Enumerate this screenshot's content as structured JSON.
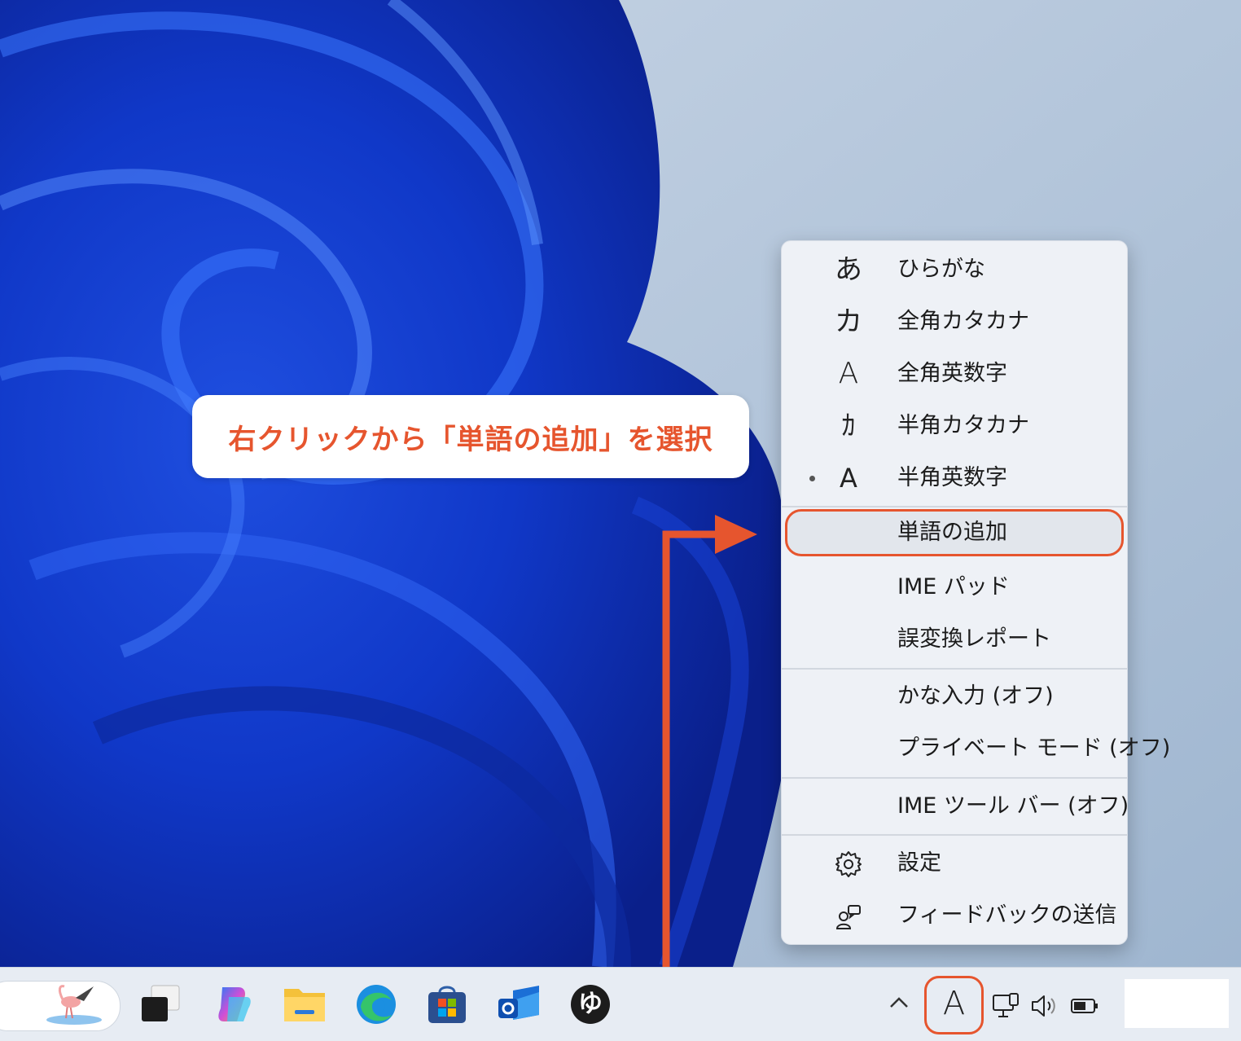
{
  "callout": {
    "text": "右クリックから「単語の追加」を選択"
  },
  "menu": {
    "items": [
      {
        "glyph": "あ",
        "label": "ひらがな",
        "selected": false
      },
      {
        "glyph": "カ",
        "label": "全角カタカナ",
        "selected": false
      },
      {
        "glyph": "A",
        "label": "全角英数字",
        "selected": false
      },
      {
        "glyph": "ｶ",
        "label": "半角カタカナ",
        "selected": false
      },
      {
        "glyph": "A",
        "label": "半角英数字",
        "selected": true
      },
      {
        "glyph": "",
        "label": "単語の追加",
        "highlighted": true
      },
      {
        "glyph": "",
        "label": "IME パッド"
      },
      {
        "glyph": "",
        "label": "誤変換レポート"
      },
      {
        "glyph": "",
        "label": "かな入力 (オフ)"
      },
      {
        "glyph": "",
        "label": "プライベート モード (オフ)"
      },
      {
        "glyph": "",
        "label": "IME ツール バー (オフ)"
      },
      {
        "icon": "gear-icon",
        "label": "設定"
      },
      {
        "icon": "feedback-icon",
        "label": "フィードバックの送信"
      }
    ]
  },
  "taskbar": {
    "apps": [
      "widgets",
      "task-view",
      "copilot",
      "file-explorer",
      "edge",
      "microsoft-store",
      "outlook",
      "yu-app"
    ],
    "yu_glyph": "ゆ",
    "tray": {
      "chevron": "^",
      "ime_mode": "A"
    }
  },
  "colors": {
    "accent": "#e6552e",
    "menu_bg": "#eef1f6"
  }
}
